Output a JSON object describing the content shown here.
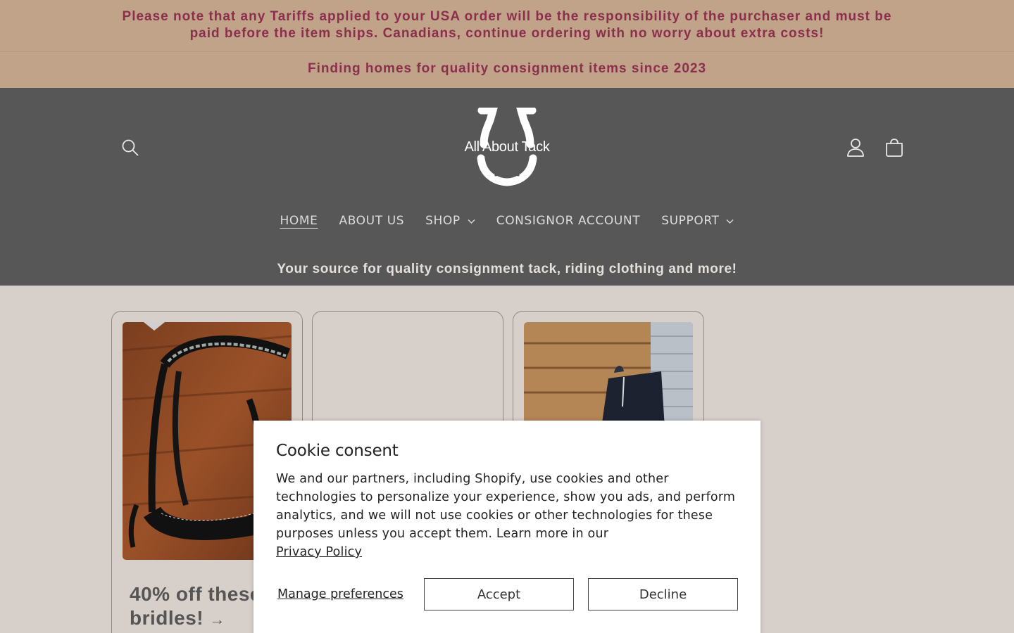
{
  "announcements": {
    "tariff": "Please note that any Tariffs applied to your USA order will be the responsibility of the purchaser and must be paid before the item ships. Canadians, continue ordering with no worry about extra costs!",
    "since": "Finding homes for quality consignment items since 2023"
  },
  "header": {
    "logo_text": "All About Tack",
    "tagline": "Your source for quality consignment tack, riding clothing and more!"
  },
  "nav": {
    "items": [
      {
        "label": "HOME",
        "active": true
      },
      {
        "label": "ABOUT US"
      },
      {
        "label": "SHOP",
        "dropdown": true
      },
      {
        "label": "CONSIGNOR ACCOUNT"
      },
      {
        "label": "SUPPORT",
        "dropdown": true
      }
    ]
  },
  "cards": [
    {
      "title_line1": "40% off these",
      "title_line2": "bridles!",
      "arrow": "→"
    },
    {},
    {}
  ],
  "cookie": {
    "title": "Cookie consent",
    "body": "We and our partners, including Shopify, use cookies and other technologies to personalize your experience, show you ads, and perform analytics, and we will not use cookies or other technologies for these purposes unless you accept them. Learn more in our",
    "privacy_link": "Privacy Policy",
    "manage": "Manage preferences",
    "accept": "Accept",
    "decline": "Decline"
  },
  "icons": {
    "search": "search-icon",
    "account": "user-icon",
    "cart": "cart-icon"
  }
}
